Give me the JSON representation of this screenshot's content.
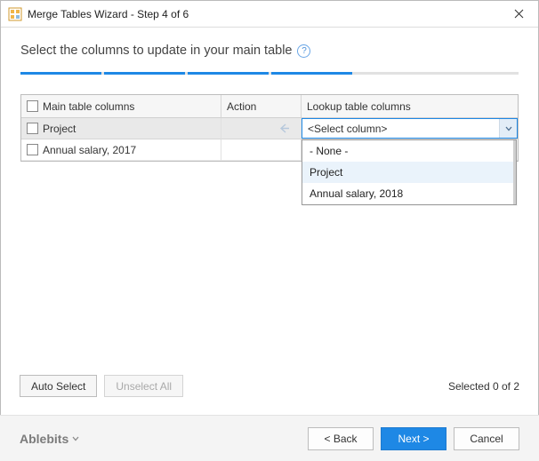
{
  "title": "Merge Tables Wizard - Step 4 of 6",
  "heading": "Select the columns to update in your main table",
  "columns": {
    "main": "Main table columns",
    "action": "Action",
    "lookup": "Lookup table columns"
  },
  "rows": [
    {
      "label": "Project",
      "selected": true,
      "combo_value": "<Select column>"
    },
    {
      "label": "Annual salary, 2017",
      "selected": false
    }
  ],
  "dropdown_options": [
    "- None -",
    "Project",
    "Annual salary, 2018"
  ],
  "dropdown_hover_index": 1,
  "buttons": {
    "auto_select": "Auto Select",
    "unselect_all": "Unselect All",
    "back": "< Back",
    "next": "Next >",
    "cancel": "Cancel"
  },
  "status": "Selected 0 of 2",
  "brand": "Ablebits"
}
